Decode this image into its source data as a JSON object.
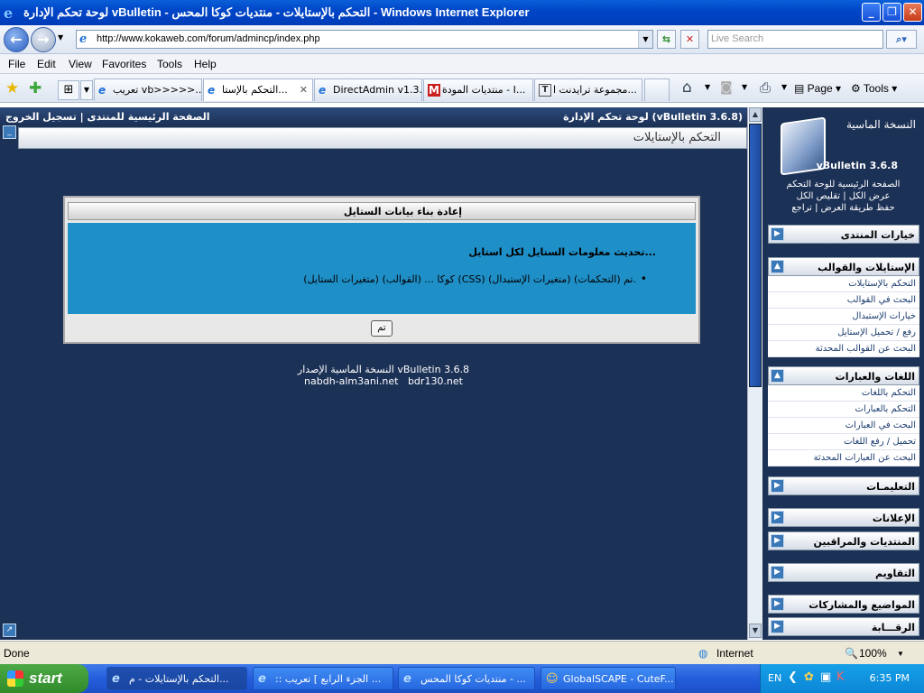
{
  "window": {
    "title": "لوحة تحكم الإدارة vBulletin - التحكم بالإستايلات - منتديات كوكا المحس - Windows Internet Explorer"
  },
  "address": {
    "url": "http://www.kokaweb.com/forum/admincp/index.php",
    "search_placeholder": "Live Search"
  },
  "menu": [
    "File",
    "Edit",
    "View",
    "Favorites",
    "Tools",
    "Help"
  ],
  "tabs": [
    {
      "label": "تعريب vb>>>>>..."
    },
    {
      "label": "التحكم بالإستا...",
      "active": true
    },
    {
      "label": "DirectAdmin v1.3..."
    },
    {
      "label": "منتديات المودة - I..."
    },
    {
      "label": "مجموعة ترايدنت ا..."
    }
  ],
  "toolbar": {
    "page": "Page",
    "tools": "Tools"
  },
  "topnav": {
    "left": "الصفحة الرئيسية للمنتدى | تسجيل الخروج",
    "right": "لوحة تحكم الإدارة (vBulletin 3.6.8)"
  },
  "page": {
    "title": "التحكم بالإستايلات"
  },
  "dialog": {
    "header": "إعادة بناء بيانات الستايل",
    "heading": "تحديث معلومات الستايل لكل استايل...",
    "item": "كوكا ... (القوالب) (متغيرات الستايل) (CSS) (متغيرات الإستبدال) (التحكمات) تم.",
    "ok": "تم"
  },
  "footer": {
    "line1": "النسخة الماسية الإصدار vBulletin 3.6.8",
    "line2": "nabdh-alm3ani.net   bdr130.net"
  },
  "sidebar": {
    "logo_title": "النسخة الماسية",
    "logo_version": "vBulletin 3.6.8",
    "links": [
      "الصفحة الرئيسية للوحة التحكم",
      "عرض الكل | تقليص الكل",
      "حفظ طريقة العرض | تراجع"
    ],
    "sections": [
      {
        "label": "خيارات المنتدى",
        "items": []
      },
      {
        "label": "الإستايلات والقوالب",
        "items": [
          "التحكم بالإستايلات",
          "البحث في القوالب",
          "خيارات الإستبدال",
          "رفع / تحميل الإستايل",
          "البحث عن القوالب المحدثة"
        ]
      },
      {
        "label": "اللغات والعبارات",
        "items": [
          "التحكم باللغات",
          "التحكم بالعبارات",
          "البحث في العبارات",
          "تحميل / رفع اللغات",
          "البحث عن العبارات المحدثة"
        ]
      },
      {
        "label": "التعليمـات",
        "items": []
      },
      {
        "label": "الإعلانات",
        "items": []
      },
      {
        "label": "المنتديات والمراقبين",
        "items": []
      },
      {
        "label": "التقاويم",
        "items": []
      },
      {
        "label": "المواضيع والمشاركات",
        "items": []
      },
      {
        "label": "الرقـــابة",
        "items": []
      }
    ]
  },
  "status": {
    "left": "Done",
    "zone": "Internet",
    "zoom": "100%"
  },
  "taskbar": {
    "start": "start",
    "tasks": [
      "التحكم بالإستايلات - م...",
      ":: الجزء الرابع ] تعريب ...",
      "منتديات كوكا المحس - ...",
      "GlobalSCAPE - CuteF..."
    ],
    "lang": "EN",
    "clock": "6:35 PM"
  }
}
